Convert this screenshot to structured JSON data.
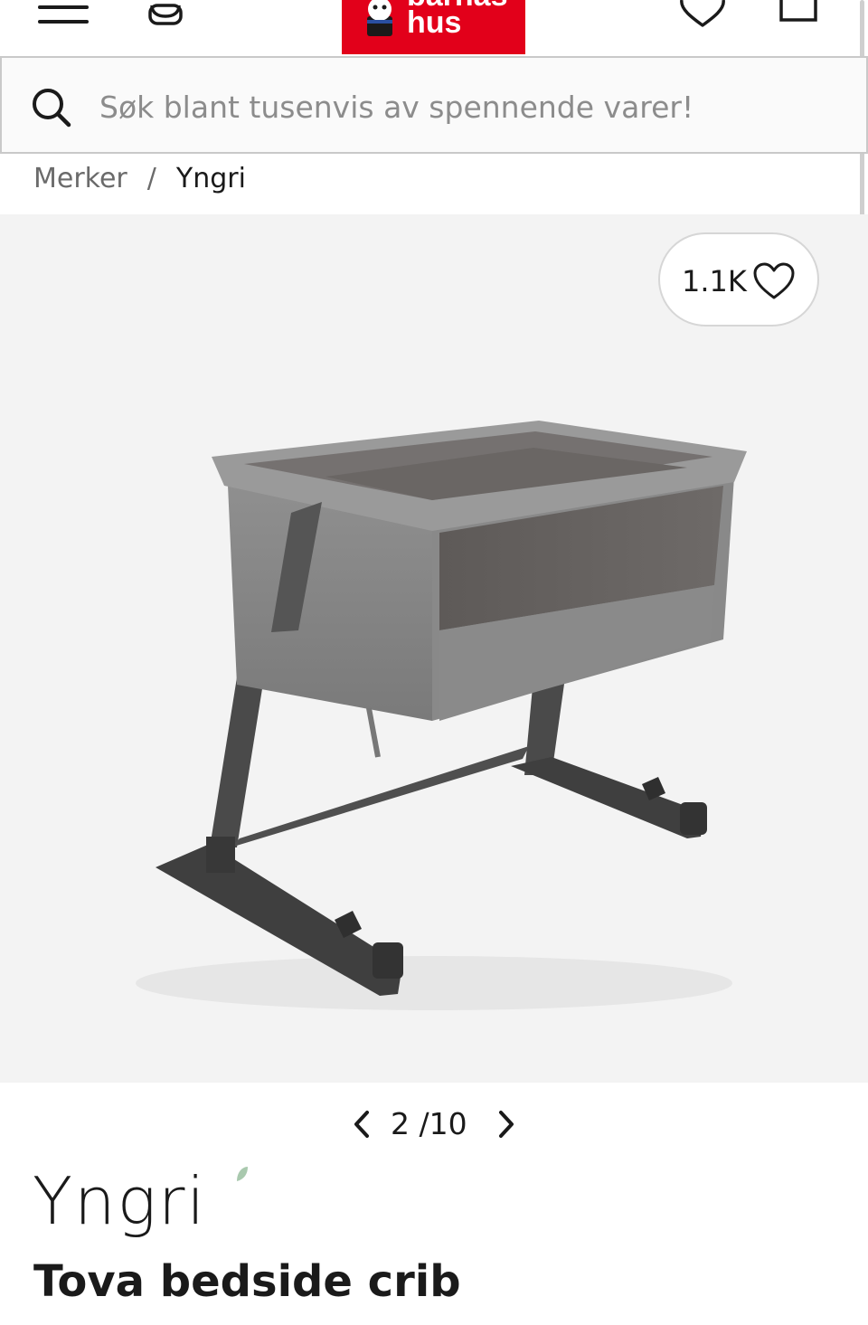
{
  "header": {
    "menu_icon": "hamburger-menu-icon",
    "account_icon": "user-account-icon",
    "logo": {
      "line1": "barnas",
      "line2": "hus",
      "color": "#e2001a"
    },
    "wishlist_icon": "heart-outline-icon",
    "cart_icon": "shopping-bag-icon"
  },
  "search": {
    "placeholder": "Søk blant tusenvis av spennende varer!",
    "value": "",
    "icon": "search-icon"
  },
  "breadcrumb": {
    "items": [
      {
        "label": "Merker"
      },
      {
        "label": "Yngri"
      }
    ],
    "separator": "/"
  },
  "gallery": {
    "likes": "1.1K",
    "like_icon": "heart-outline-icon",
    "image_subject": "grey bedside crib on dark metal frame",
    "pager": {
      "current": "2",
      "separator": "/",
      "total": "10"
    }
  },
  "product": {
    "brand": "Yngri",
    "brand_accent_color": "#a9c9ae",
    "title": "Tova bedside crib"
  }
}
